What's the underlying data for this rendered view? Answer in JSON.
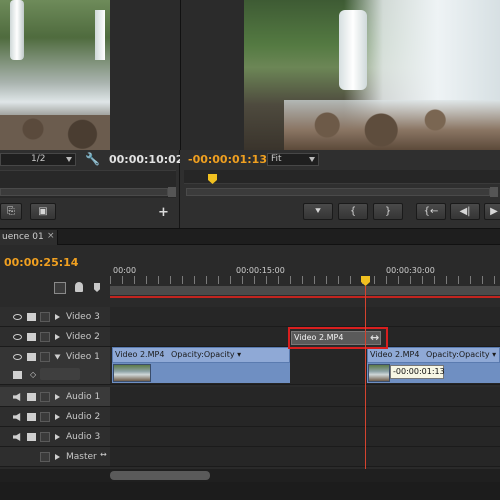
{
  "source_monitor": {
    "zoom_value": "1/2",
    "timecode": "00:00:10:02"
  },
  "program_monitor": {
    "timecode": "-00:00:01:13",
    "zoom_value": "Fit"
  },
  "controls": {
    "plus_label": "+",
    "marker": "⯆",
    "mark_in": "{",
    "mark_out": "}",
    "go_to_in": "{←",
    "step_back": "◀|",
    "play": "▶"
  },
  "timeline": {
    "tab_label": "uence 01",
    "tab_close": "×",
    "timecode": "00:00:25:14",
    "ruler": [
      "00:00",
      "00:00:15:00",
      "00:00:30:00"
    ],
    "tracks": [
      {
        "name": "Video 3"
      },
      {
        "name": "Video 2"
      },
      {
        "name": "Video 1"
      },
      {
        "name": "Audio 1"
      },
      {
        "name": "Audio 2"
      },
      {
        "name": "Audio 3"
      },
      {
        "name": "Master"
      }
    ],
    "clips": {
      "video1_a_label": "Video 2.MP4",
      "video1_a_fx": "Opacity:Opacity ▾",
      "video1_b_label": "Video 2.MP4",
      "video1_b_fx": "Opacity:Opacity ▾",
      "dragged_label": "Video 2.MP4"
    },
    "tooltip": "-00:00:01:13"
  }
}
